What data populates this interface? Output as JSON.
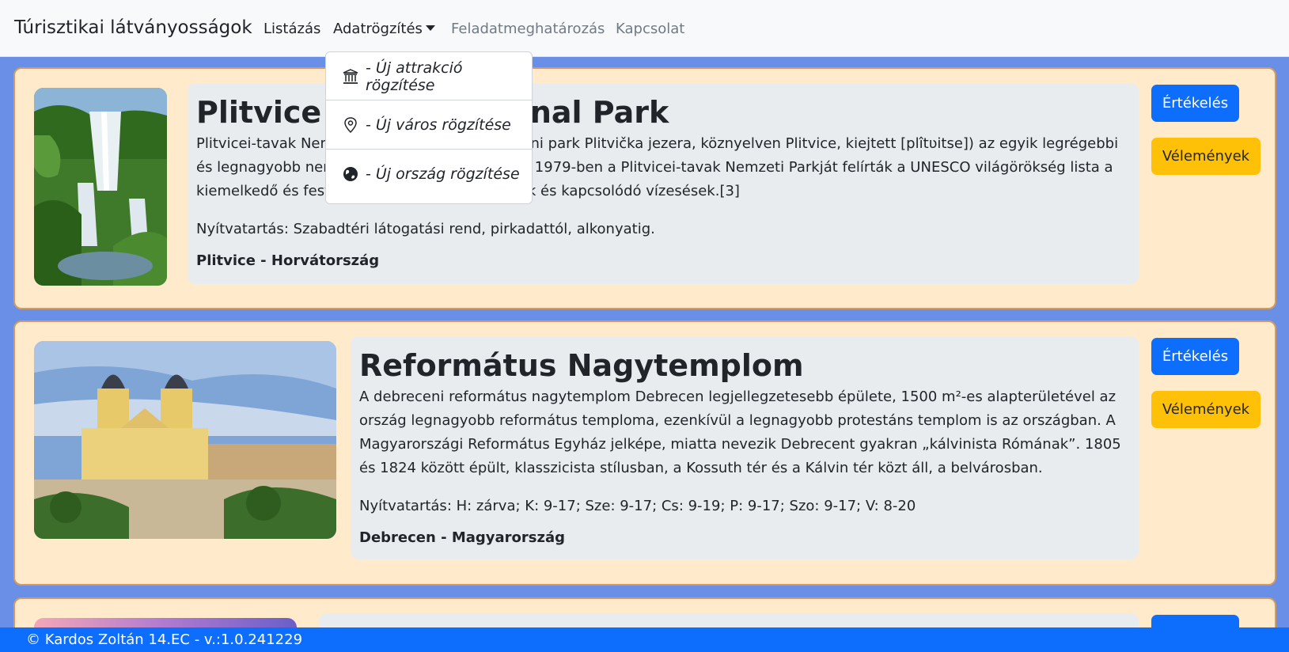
{
  "navbar": {
    "brand": "Túrisztikai látványosságok",
    "links": {
      "listing": "Listázás",
      "data_entry": "Adatrögzítés",
      "task": "Feladatmeghatározás",
      "contact": "Kapcsolat"
    }
  },
  "dropdown": {
    "items": [
      {
        "label": "- Új attrakció rögzítése",
        "icon": "landmark-icon"
      },
      {
        "label": "- Új város rögzítése",
        "icon": "map-pin-icon"
      },
      {
        "label": "- Új ország rögzítése",
        "icon": "globe-icon"
      }
    ]
  },
  "cards": [
    {
      "title": "Plitvice Lakes National Park",
      "text": "Plitvicei-tavak Nemzeti Park (horvátul Nacionalni park Plitvička jezera, köznyelven Plitvice, kiejtett [plîtʋitse]) az egyik legrégebbi és legnagyobb nemzeti park Horvátországban. 1979-ben a Plitvicei-tavak Nemzeti Parkját felírták a UNESCO világörökség lista a kiemelkedő és festői sorozatos tavai, barlangok és kapcsolódó vízesések.[3]",
      "hours": "Nyítvatartás: Szabadtéri látogatási rend, pirkadattól, alkonyatig.",
      "location": "Plitvice - Horvátország",
      "rate_label": "Értékelés",
      "reviews_label": "Vélemények"
    },
    {
      "title": "Református Nagytemplom",
      "text": "A debreceni református nagytemplom Debrecen legjellegzetesebb épülete, 1500 m²-es alapterületével az ország legnagyobb református temploma, ezenkívül a legnagyobb protestáns templom is az országban. A Magyarországi Református Egyház jelképe, miatta nevezik Debrecent gyakran „kálvinista Rómának”. 1805 és 1824 között épült, klasszicista stílusban, a Kossuth tér és a Kálvin tér közt áll, a belvárosban.",
      "hours": "Nyítvatartás: H: zárva; K: 9-17; Sze: 9-17; Cs: 9-19; P: 9-17; Szo: 9-17; V: 8-20",
      "location": "Debrecen - Magyarország",
      "rate_label": "Értékelés",
      "reviews_label": "Vélemények"
    }
  ],
  "footer": {
    "text": "© Kardos Zoltán 14.EC - v.:1.0.241229"
  },
  "colors": {
    "page_bg": "#6a8fe6",
    "card_bg": "#ffeacc",
    "primary": "#0d6efd",
    "warning": "#ffc107"
  }
}
